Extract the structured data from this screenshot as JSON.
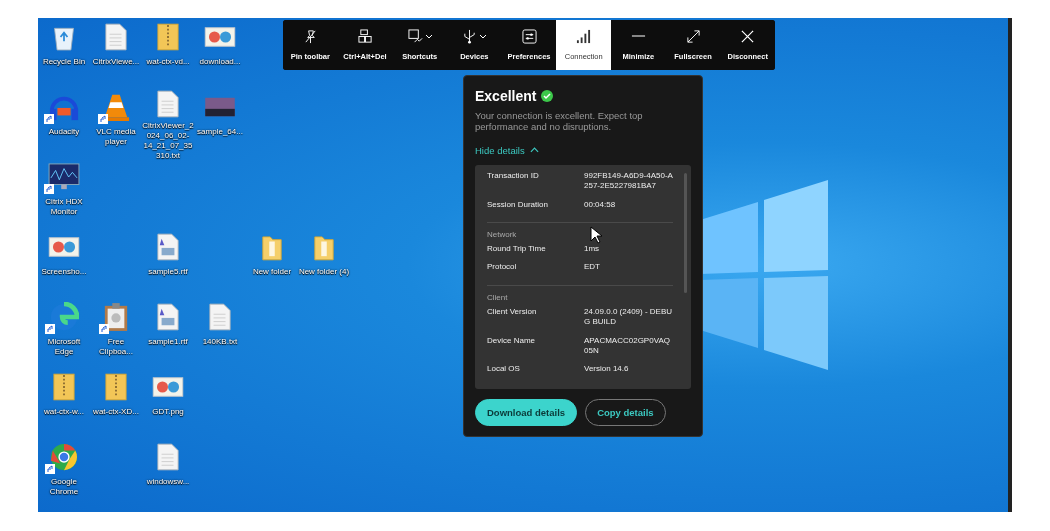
{
  "desktop": {
    "icons": [
      {
        "label": "Recycle Bin",
        "kind": "recycle-bin",
        "shortcut": false
      },
      {
        "label": "CitrixViewe...",
        "kind": "document",
        "shortcut": false
      },
      {
        "label": "wat-ctx-vd...",
        "kind": "zip-folder",
        "shortcut": false
      },
      {
        "label": "download...",
        "kind": "image",
        "shortcut": false
      },
      {
        "label": "Audacity",
        "kind": "headphones",
        "shortcut": true
      },
      {
        "label": "VLC media player",
        "kind": "cone",
        "shortcut": true
      },
      {
        "label": "CitrixViewer_2024_06_02-14_21_07_35310.txt",
        "kind": "document",
        "shortcut": false
      },
      {
        "label": "sample_64...",
        "kind": "photo",
        "shortcut": false
      },
      {
        "label": "Citrix HDX Monitor",
        "kind": "monitor",
        "shortcut": true
      },
      {
        "label": "Screensho...",
        "kind": "image",
        "shortcut": false
      },
      {
        "label": "sample5.rtf",
        "kind": "rich-document",
        "shortcut": false
      },
      {
        "label": "New folder",
        "kind": "folder",
        "shortcut": false
      },
      {
        "label": "New folder (4)",
        "kind": "folder",
        "shortcut": false
      },
      {
        "label": "Microsoft Edge",
        "kind": "edge",
        "shortcut": true
      },
      {
        "label": "Free Clipboa...",
        "kind": "clipboard",
        "shortcut": true
      },
      {
        "label": "sample1.rtf",
        "kind": "rich-document",
        "shortcut": false
      },
      {
        "label": "140KB.txt",
        "kind": "document",
        "shortcut": false
      },
      {
        "label": "wat-ctx-w...",
        "kind": "zip-folder",
        "shortcut": false
      },
      {
        "label": "wat-ctx-XD...",
        "kind": "zip-folder",
        "shortcut": false
      },
      {
        "label": "GDT.png",
        "kind": "image",
        "shortcut": false
      },
      {
        "label": "Google Chrome",
        "kind": "chrome",
        "shortcut": true
      },
      {
        "label": "windowsw...",
        "kind": "document",
        "shortcut": false
      }
    ]
  },
  "toolbar": {
    "buttons": [
      {
        "label": "Pin toolbar",
        "kind": "pin",
        "selected": false,
        "dropdown": false
      },
      {
        "label": "Ctrl+Alt+Del",
        "kind": "keys",
        "selected": false,
        "dropdown": false
      },
      {
        "label": "Shortcuts",
        "kind": "shortcuts",
        "selected": false,
        "dropdown": true
      },
      {
        "label": "Devices",
        "kind": "usb",
        "selected": false,
        "dropdown": true
      },
      {
        "label": "Preferences",
        "kind": "sliders",
        "selected": false,
        "dropdown": false
      },
      {
        "label": "Connection",
        "kind": "signal",
        "selected": true,
        "dropdown": false
      },
      {
        "label": "Minimize",
        "kind": "minimize",
        "selected": false,
        "dropdown": false
      },
      {
        "label": "Fullscreen",
        "kind": "fullscreen",
        "selected": false,
        "dropdown": false
      },
      {
        "label": "Disconnect",
        "kind": "close",
        "selected": false,
        "dropdown": false
      }
    ]
  },
  "connection_panel": {
    "status": "Excellent",
    "description": "Your connection is excellent. Expect top performance and no disruptions.",
    "toggle": "Hide details",
    "details": [
      {
        "rows": [
          {
            "label": "Transaction ID",
            "value": "992FB149-A6D9-4A50-A257-2E5227981BA7"
          },
          {
            "label": "Session Duration",
            "value": "00:04:58"
          }
        ]
      },
      {
        "heading": "Network",
        "rows": [
          {
            "label": "Round Trip Time",
            "value": "1ms"
          },
          {
            "label": "Protocol",
            "value": "EDT"
          }
        ]
      },
      {
        "heading": "Client",
        "rows": [
          {
            "label": "Client Version",
            "value": "24.09.0.0 (2409) - DEBUG BUILD"
          },
          {
            "label": "Device Name",
            "value": "APACMACC02GP0VAQ05N"
          },
          {
            "label": "Local OS",
            "value": "Version 14.6"
          }
        ]
      }
    ],
    "buttons": [
      {
        "label": "Download details",
        "kind": "primary"
      },
      {
        "label": "Copy details",
        "kind": "secondary"
      }
    ]
  }
}
